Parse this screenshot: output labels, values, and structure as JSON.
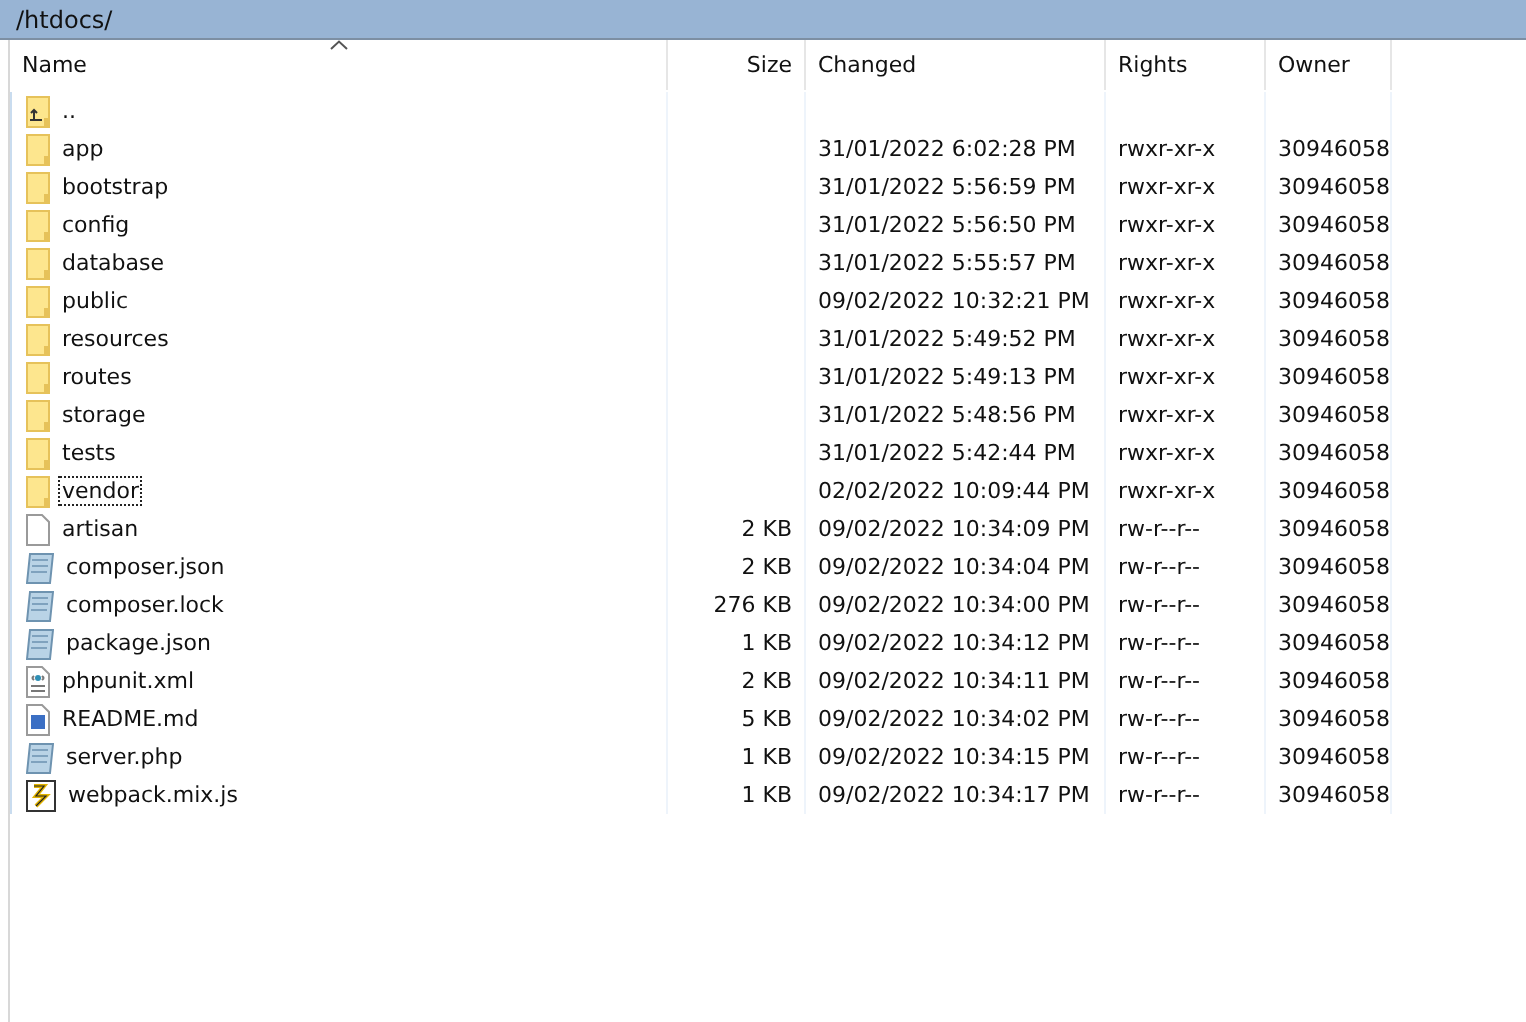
{
  "path_bar": {
    "title": "/htdocs/"
  },
  "columns": [
    {
      "label": "Name",
      "sorted": true
    },
    {
      "label": "Size",
      "sorted": false
    },
    {
      "label": "Changed",
      "sorted": false
    },
    {
      "label": "Rights",
      "sorted": false
    },
    {
      "label": "Owner",
      "sorted": false
    }
  ],
  "rows": [
    {
      "kind": "parent",
      "name": "..",
      "focused": false
    },
    {
      "kind": "folder",
      "name": "app",
      "changed": "31/01/2022 6:02:28 PM",
      "rights": "rwxr-xr-x",
      "owner": "30946058",
      "focused": false
    },
    {
      "kind": "folder",
      "name": "bootstrap",
      "changed": "31/01/2022 5:56:59 PM",
      "rights": "rwxr-xr-x",
      "owner": "30946058",
      "focused": false
    },
    {
      "kind": "folder",
      "name": "config",
      "changed": "31/01/2022 5:56:50 PM",
      "rights": "rwxr-xr-x",
      "owner": "30946058",
      "focused": false
    },
    {
      "kind": "folder",
      "name": "database",
      "changed": "31/01/2022 5:55:57 PM",
      "rights": "rwxr-xr-x",
      "owner": "30946058",
      "focused": false
    },
    {
      "kind": "folder",
      "name": "public",
      "changed": "09/02/2022 10:32:21 PM",
      "rights": "rwxr-xr-x",
      "owner": "30946058",
      "focused": false
    },
    {
      "kind": "folder",
      "name": "resources",
      "changed": "31/01/2022 5:49:52 PM",
      "rights": "rwxr-xr-x",
      "owner": "30946058",
      "focused": false
    },
    {
      "kind": "folder",
      "name": "routes",
      "changed": "31/01/2022 5:49:13 PM",
      "rights": "rwxr-xr-x",
      "owner": "30946058",
      "focused": false
    },
    {
      "kind": "folder",
      "name": "storage",
      "changed": "31/01/2022 5:48:56 PM",
      "rights": "rwxr-xr-x",
      "owner": "30946058",
      "focused": false
    },
    {
      "kind": "folder",
      "name": "tests",
      "changed": "31/01/2022 5:42:44 PM",
      "rights": "rwxr-xr-x",
      "owner": "30946058",
      "focused": false
    },
    {
      "kind": "folder",
      "name": "vendor",
      "changed": "02/02/2022 10:09:44 PM",
      "rights": "rwxr-xr-x",
      "owner": "30946058",
      "focused": true
    },
    {
      "kind": "file",
      "name": "artisan",
      "size": "2 KB",
      "changed": "09/02/2022 10:34:09 PM",
      "rights": "rw-r--r--",
      "owner": "30946058",
      "focused": false
    },
    {
      "kind": "text",
      "name": "composer.json",
      "size": "2 KB",
      "changed": "09/02/2022 10:34:04 PM",
      "rights": "rw-r--r--",
      "owner": "30946058",
      "focused": false
    },
    {
      "kind": "text",
      "name": "composer.lock",
      "size": "276 KB",
      "changed": "09/02/2022 10:34:00 PM",
      "rights": "rw-r--r--",
      "owner": "30946058",
      "focused": false
    },
    {
      "kind": "text",
      "name": "package.json",
      "size": "1 KB",
      "changed": "09/02/2022 10:34:12 PM",
      "rights": "rw-r--r--",
      "owner": "30946058",
      "focused": false
    },
    {
      "kind": "xml",
      "name": "phpunit.xml",
      "size": "2 KB",
      "changed": "09/02/2022 10:34:11 PM",
      "rights": "rw-r--r--",
      "owner": "30946058",
      "focused": false
    },
    {
      "kind": "doc",
      "name": "README.md",
      "size": "5 KB",
      "changed": "09/02/2022 10:34:02 PM",
      "rights": "rw-r--r--",
      "owner": "30946058",
      "focused": false
    },
    {
      "kind": "text",
      "name": "server.php",
      "size": "1 KB",
      "changed": "09/02/2022 10:34:15 PM",
      "rights": "rw-r--r--",
      "owner": "30946058",
      "focused": false
    },
    {
      "kind": "script",
      "name": "webpack.mix.js",
      "size": "1 KB",
      "changed": "09/02/2022 10:34:17 PM",
      "rights": "rw-r--r--",
      "owner": "30946058",
      "focused": false
    }
  ]
}
